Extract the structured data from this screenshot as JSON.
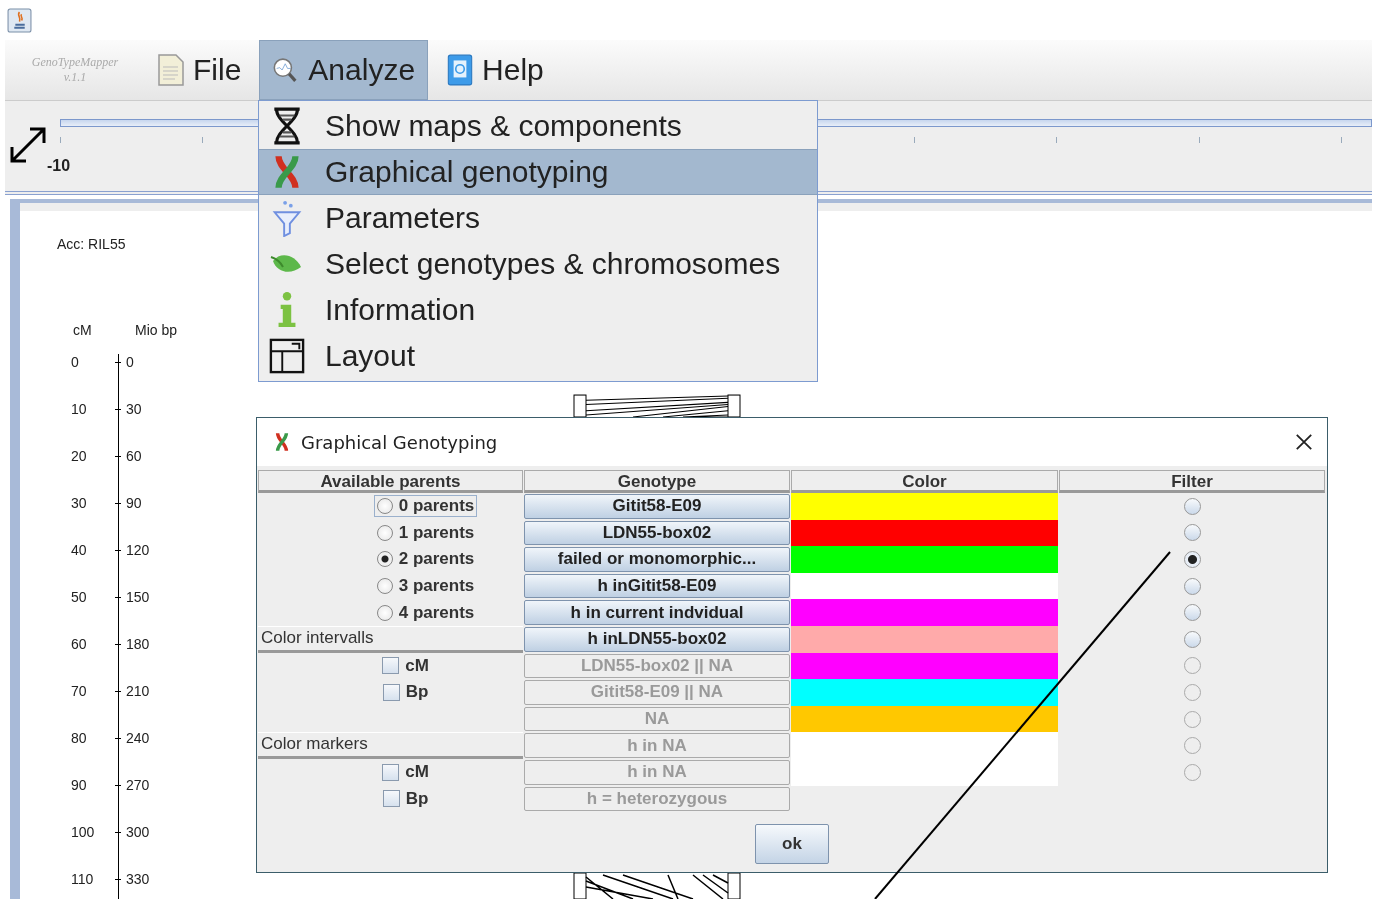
{
  "app": {
    "logo_name": "GenoTypeMapper",
    "logo_version": "v.1.1"
  },
  "menubar": [
    {
      "label": "File",
      "selected": false
    },
    {
      "label": "Analyze",
      "selected": true
    },
    {
      "label": "Help",
      "selected": false
    }
  ],
  "menu": [
    {
      "label": "Show maps & components",
      "selected": false
    },
    {
      "label": "Graphical genotyping",
      "selected": true
    },
    {
      "label": "Parameters",
      "selected": false
    },
    {
      "label": "Select genotypes & chromosomes",
      "selected": false
    },
    {
      "label": "Information",
      "selected": false
    },
    {
      "label": "Layout",
      "selected": false
    }
  ],
  "ruler": {
    "label": "-10"
  },
  "map": {
    "accession": "Acc: RIL55",
    "headers": [
      "cM",
      "Mio bp"
    ],
    "scale": [
      {
        "cm": "0",
        "bp": "0"
      },
      {
        "cm": "10",
        "bp": "30"
      },
      {
        "cm": "20",
        "bp": "60"
      },
      {
        "cm": "30",
        "bp": "90"
      },
      {
        "cm": "40",
        "bp": "120"
      },
      {
        "cm": "50",
        "bp": "150"
      },
      {
        "cm": "60",
        "bp": "180"
      },
      {
        "cm": "70",
        "bp": "210"
      },
      {
        "cm": "80",
        "bp": "240"
      },
      {
        "cm": "90",
        "bp": "270"
      },
      {
        "cm": "100",
        "bp": "300"
      },
      {
        "cm": "110",
        "bp": "330"
      }
    ]
  },
  "dialog": {
    "title": "Graphical Genotyping",
    "columns": [
      "Available parents",
      "Genotype",
      "Color",
      "Filter"
    ],
    "parents": [
      {
        "label": "0 parents",
        "selected": false,
        "focused": true
      },
      {
        "label": "1 parents",
        "selected": false,
        "focused": false
      },
      {
        "label": "2 parents",
        "selected": true,
        "focused": false
      },
      {
        "label": "3 parents",
        "selected": false,
        "focused": false
      },
      {
        "label": "4 parents",
        "selected": false,
        "focused": false
      }
    ],
    "color_intervals": {
      "label": "Color intervalls",
      "options": [
        {
          "label": "cM",
          "checked": false
        },
        {
          "label": "Bp",
          "checked": false
        }
      ]
    },
    "color_markers": {
      "label": "Color markers",
      "options": [
        {
          "label": "cM",
          "checked": false
        },
        {
          "label": "Bp",
          "checked": false
        }
      ]
    },
    "genotypes": [
      {
        "label": "Gitit58-E09",
        "disabled": false,
        "color": "#ffff00",
        "filter_selected": false
      },
      {
        "label": "LDN55-box02",
        "disabled": false,
        "color": "#ff0000",
        "filter_selected": false
      },
      {
        "label": "failed or monomorphic...",
        "disabled": false,
        "color": "#00ff00",
        "filter_selected": true
      },
      {
        "label": "h inGitit58-E09",
        "disabled": false,
        "color": "#ffffff",
        "filter_selected": false
      },
      {
        "label": "h in current indvidual",
        "disabled": false,
        "color": "#ff00ff",
        "filter_selected": false
      },
      {
        "label": "h inLDN55-box02",
        "disabled": false,
        "color": "#ffaaaa",
        "filter_selected": false
      },
      {
        "label": "LDN55-box02 || NA",
        "disabled": true,
        "color": "#ff00ff",
        "filter_selected": false
      },
      {
        "label": "Gitit58-E09 || NA",
        "disabled": true,
        "color": "#00ffff",
        "filter_selected": false
      },
      {
        "label": "NA",
        "disabled": true,
        "color": "#ffc800",
        "filter_selected": false
      },
      {
        "label": "h in NA",
        "disabled": true,
        "color": "#ffffff",
        "filter_selected": false
      },
      {
        "label": "h in NA",
        "disabled": true,
        "color": "#ffffff",
        "filter_selected": false
      }
    ],
    "legend": "h = heterozygous",
    "ok_button": "ok"
  }
}
